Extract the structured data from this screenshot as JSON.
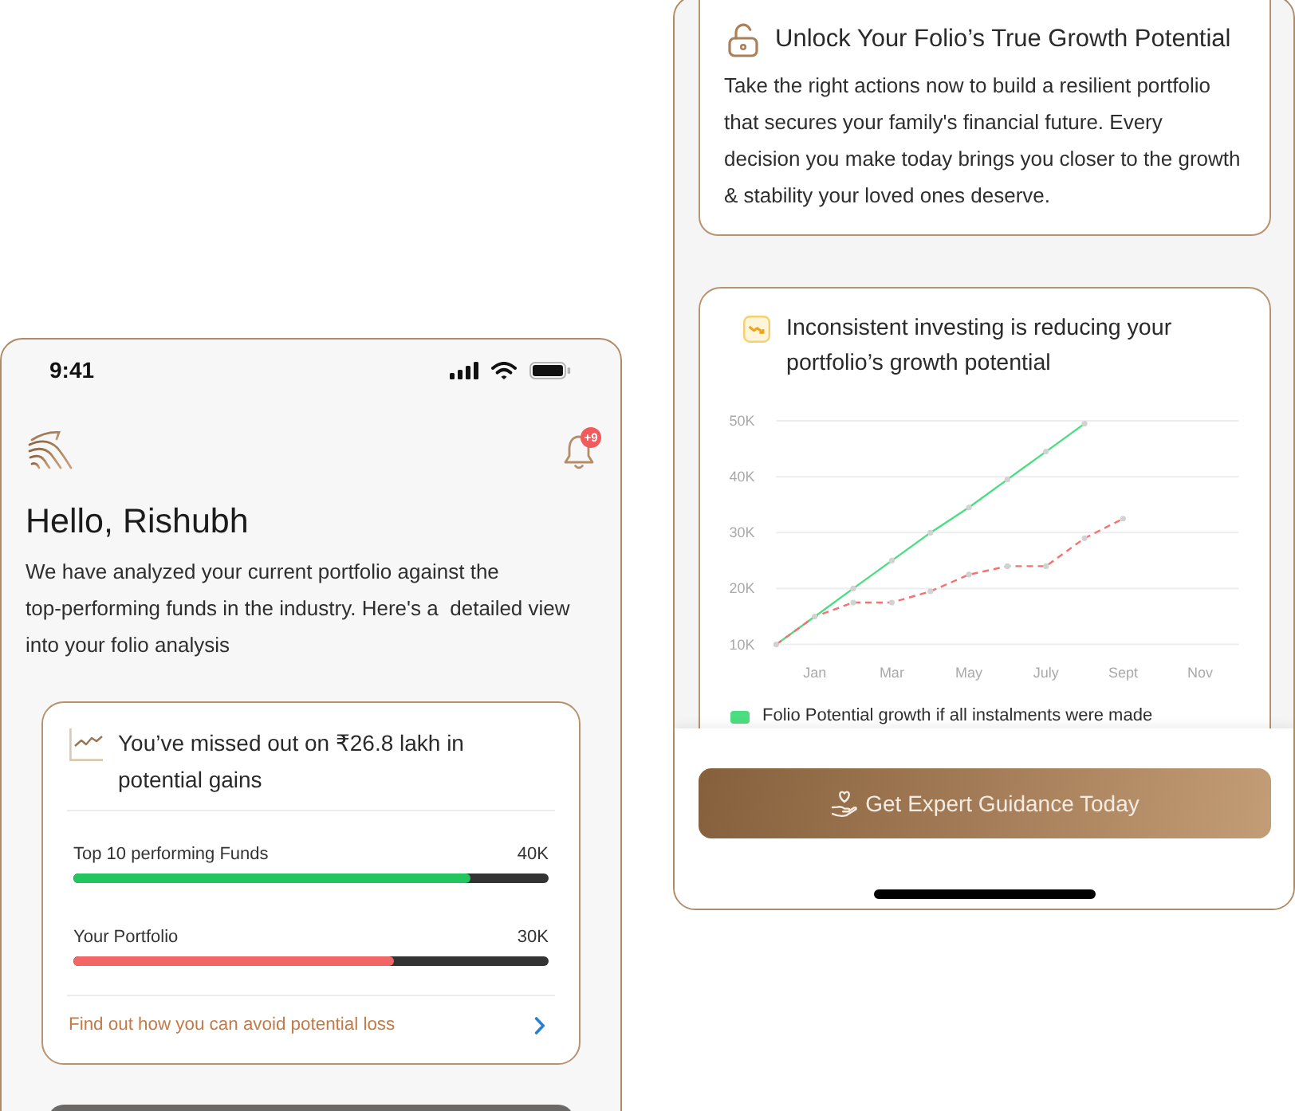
{
  "home_screen": {
    "status_bar": {
      "time": "9:41"
    },
    "notification_badge": "+9",
    "greeting": "Hello, Rishubh",
    "intro": "We have analyzed your current portfolio against the top-performing funds in the industry. Here's a  detailed view into your folio analysis",
    "missed_gains_card": {
      "title": "You’ve missed out on ₹26.8 lakh in potential gains",
      "comparisons": [
        {
          "label": "Top 10 performing Funds",
          "value": "40K",
          "level": 0.835,
          "color": "#22c55e"
        },
        {
          "label": "Your Portfolio",
          "value": "30K",
          "level": 0.674,
          "color": "#f26666"
        }
      ],
      "link": "Find out how you can avoid potential loss"
    }
  },
  "growth_screen": {
    "unlock_card": {
      "title": "Unlock Your Folio’s True Growth Potential",
      "body": "Take the right actions now to build a resilient portfolio that secures your family's financial future. Every decision you make today brings you closer to the growth & stability your loved ones deserve."
    },
    "insight_card": {
      "title": "Inconsistent investing is reducing your portfolio’s growth potential",
      "chart_data": {
        "type": "line",
        "grid": true,
        "categories": [
          null,
          "Jan",
          null,
          "Mar",
          null,
          "May",
          null,
          "July",
          null,
          "Sept",
          null,
          "Nov",
          null
        ],
        "ylim": [
          10000,
          50000
        ],
        "yticks": [
          {
            "value": 10000,
            "label": "10K"
          },
          {
            "value": 20000,
            "label": "20K"
          },
          {
            "value": 30000,
            "label": "30K"
          },
          {
            "value": 40000,
            "label": "40K"
          },
          {
            "value": 50000,
            "label": "50K"
          }
        ],
        "series": [
          {
            "name": "Folio Potential growth if all instalments were made",
            "color": "#4ade80",
            "line_style": "solid",
            "marker": "circle",
            "values": [
              10000,
              15000,
              20000,
              25000,
              30000,
              34500,
              39500,
              44500,
              49500,
              null,
              null,
              null,
              null
            ]
          },
          {
            "color": "#f87171",
            "line_style": "dashed",
            "marker": "circle",
            "values": [
              10000,
              15000,
              17500,
              17500,
              19500,
              22500,
              24000,
              24000,
              29000,
              32500,
              null,
              null,
              null
            ]
          }
        ]
      }
    },
    "cta_button": "Get Expert Guidance Today"
  }
}
